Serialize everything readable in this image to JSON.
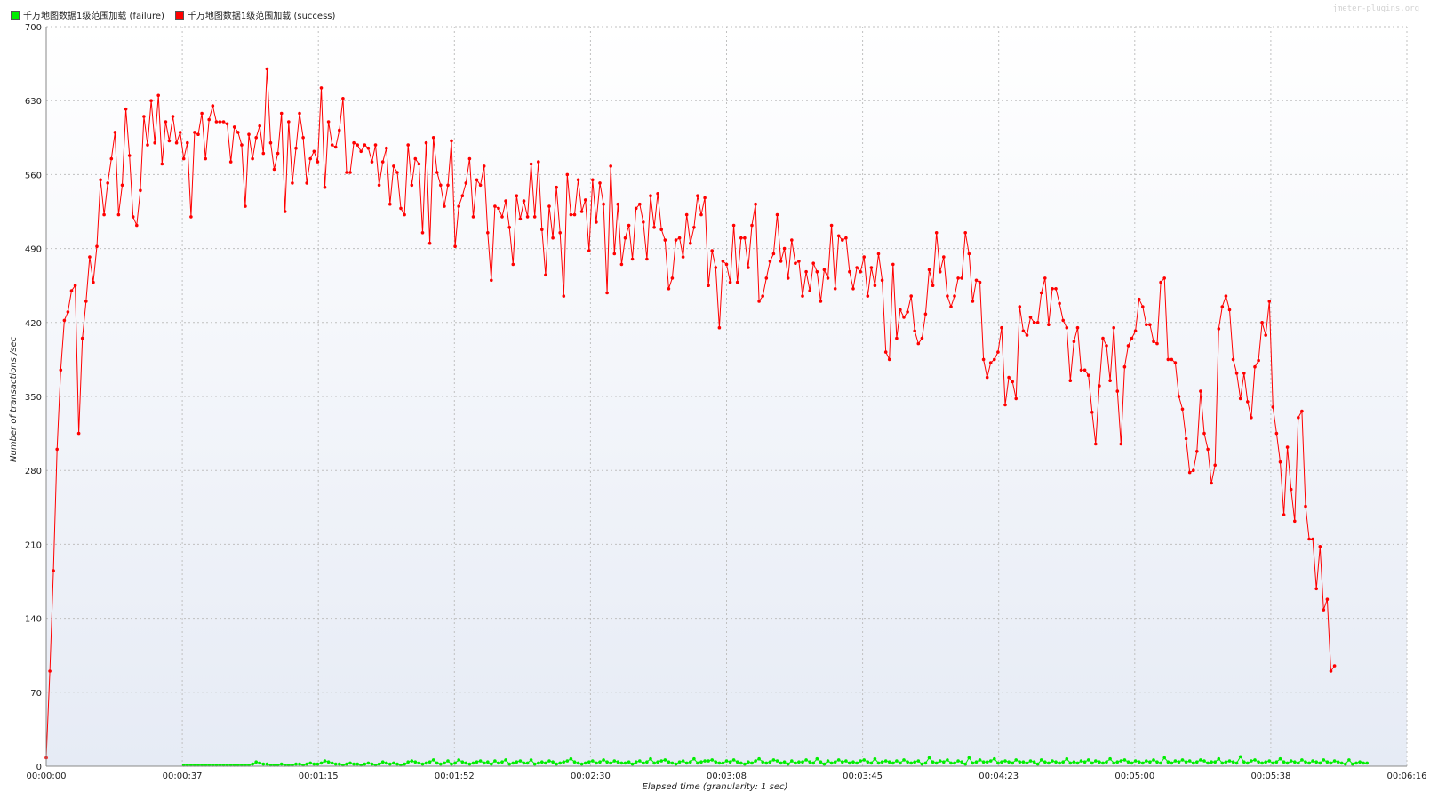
{
  "watermark": "jmeter-plugins.org",
  "colors": {
    "failure": "#00ee00",
    "success": "#ff0000",
    "grid": "#c0c0c0",
    "plot_bg_top": "#ffffff",
    "plot_bg_bottom": "#e6ebf5"
  },
  "legend": [
    {
      "label": "千万地图数据1级范围加载 (failure)",
      "color": "#00ee00"
    },
    {
      "label": "千万地图数据1级范围加载 (success)",
      "color": "#ff0000"
    }
  ],
  "chart_data": {
    "type": "line",
    "title": "",
    "xlabel": "Elapsed time (granularity: 1 sec)",
    "ylabel": "Number of transactions /sec",
    "xlim_seconds": [
      0,
      376
    ],
    "ylim": [
      0,
      700
    ],
    "y_ticks": [
      0,
      70,
      140,
      210,
      280,
      350,
      420,
      490,
      560,
      630,
      700
    ],
    "x_ticks": [
      "00:00:00",
      "00:00:37",
      "00:01:15",
      "00:01:52",
      "00:02:30",
      "00:03:08",
      "00:03:45",
      "00:04:23",
      "00:05:00",
      "00:05:38",
      "00:06:16"
    ],
    "grid": true,
    "legend_position": "top-left",
    "series": [
      {
        "name": "千万地图数据1级范围加载 (failure)",
        "color": "#00ee00",
        "x_start_seconds": 38,
        "x_step_seconds": 1,
        "values": [
          1,
          1,
          1,
          1,
          1,
          1,
          1,
          1,
          1,
          1,
          1,
          1,
          1,
          1,
          1,
          1,
          1,
          1,
          1,
          2,
          4,
          3,
          2,
          2,
          1,
          1,
          1,
          2,
          1,
          1,
          1,
          2,
          2,
          1,
          2,
          3,
          2,
          2,
          3,
          5,
          4,
          3,
          2,
          2,
          1,
          2,
          3,
          2,
          2,
          1,
          2,
          3,
          2,
          1,
          2,
          4,
          3,
          2,
          3,
          2,
          1,
          2,
          4,
          5,
          4,
          3,
          2,
          3,
          4,
          6,
          3,
          2,
          3,
          5,
          2,
          3,
          6,
          4,
          3,
          2,
          3,
          4,
          5,
          3,
          4,
          2,
          5,
          3,
          4,
          6,
          2,
          3,
          4,
          5,
          3,
          3,
          6,
          2,
          3,
          4,
          3,
          5,
          4,
          2,
          3,
          4,
          5,
          7,
          4,
          3,
          2,
          3,
          4,
          5,
          3,
          4,
          6,
          4,
          3,
          5,
          4,
          3,
          3,
          4,
          2,
          4,
          5,
          3,
          4,
          7,
          3,
          4,
          5,
          6,
          4,
          3,
          2,
          4,
          5,
          3,
          4,
          7,
          3,
          4,
          5,
          5,
          6,
          4,
          3,
          3,
          5,
          4,
          6,
          4,
          3,
          2,
          4,
          3,
          5,
          7,
          4,
          3,
          4,
          6,
          5,
          3,
          4,
          2,
          5,
          3,
          4,
          4,
          6,
          4,
          3,
          7,
          4,
          2,
          5,
          3,
          4,
          6,
          4,
          5,
          3,
          4,
          3,
          5,
          6,
          4,
          3,
          7,
          3,
          4,
          5,
          4,
          3,
          5,
          3,
          6,
          4,
          3,
          4,
          5,
          2,
          3,
          8,
          4,
          3,
          5,
          4,
          6,
          3,
          3,
          5,
          4,
          2,
          8,
          3,
          4,
          6,
          4,
          4,
          5,
          7,
          3,
          4,
          5,
          4,
          3,
          6,
          4,
          4,
          3,
          5,
          4,
          2,
          6,
          4,
          3,
          5,
          4,
          3,
          4,
          7,
          3,
          4,
          3,
          5,
          4,
          6,
          3,
          5,
          4,
          3,
          4,
          7,
          3,
          4,
          5,
          6,
          4,
          3,
          5,
          4,
          3,
          5,
          4,
          6,
          4,
          3,
          8,
          4,
          3,
          5,
          4,
          6,
          4,
          5,
          3,
          4,
          6,
          5,
          3,
          4,
          4,
          7,
          3,
          4,
          5,
          4,
          3,
          9,
          4,
          3,
          5,
          6,
          4,
          3,
          4,
          5,
          3,
          4,
          7,
          4,
          3,
          5,
          4,
          3,
          6,
          4,
          3,
          5,
          4,
          3,
          6,
          4,
          3,
          5,
          4,
          3,
          2,
          6,
          2,
          3,
          4,
          3,
          3
        ]
      },
      {
        "name": "千万地图数据1级范围加载 (success)",
        "color": "#ff0000",
        "x_start_seconds": 0,
        "x_step_seconds": 1,
        "values": [
          8,
          90,
          185,
          300,
          375,
          422,
          430,
          450,
          455,
          315,
          405,
          440,
          482,
          458,
          492,
          555,
          522,
          552,
          575,
          600,
          522,
          550,
          622,
          578,
          520,
          512,
          545,
          615,
          588,
          630,
          590,
          635,
          570,
          610,
          592,
          615,
          590,
          600,
          575,
          590,
          520,
          600,
          598,
          618,
          575,
          612,
          625,
          610,
          610,
          610,
          608,
          572,
          605,
          600,
          588,
          530,
          598,
          575,
          595,
          606,
          580,
          660,
          590,
          565,
          580,
          618,
          525,
          610,
          552,
          585,
          618,
          595,
          552,
          575,
          582,
          572,
          642,
          548,
          610,
          588,
          586,
          602,
          632,
          562,
          562,
          590,
          588,
          582,
          588,
          585,
          572,
          588,
          550,
          572,
          585,
          532,
          568,
          562,
          528,
          522,
          588,
          550,
          575,
          570,
          505,
          590,
          495,
          595,
          562,
          550,
          530,
          550,
          592,
          492,
          530,
          540,
          552,
          575,
          520,
          555,
          550,
          568,
          505,
          460,
          530,
          528,
          520,
          535,
          510,
          475,
          540,
          518,
          535,
          520,
          570,
          520,
          572,
          508,
          465,
          530,
          500,
          548,
          505,
          445,
          560,
          522,
          522,
          555,
          525,
          536,
          488,
          555,
          515,
          552,
          532,
          448,
          568,
          485,
          532,
          475,
          500,
          512,
          480,
          528,
          532,
          515,
          480,
          540,
          510,
          542,
          508,
          498,
          452,
          462,
          498,
          500,
          482,
          522,
          495,
          510,
          540,
          522,
          538,
          455,
          488,
          472,
          415,
          478,
          475,
          458,
          512,
          458,
          500,
          500,
          472,
          512,
          532,
          440,
          445,
          462,
          478,
          485,
          522,
          478,
          490,
          462,
          498,
          476,
          478,
          445,
          468,
          450,
          476,
          468,
          440,
          470,
          462,
          512,
          452,
          502,
          498,
          500,
          468,
          452,
          472,
          468,
          482,
          445,
          472,
          455,
          485,
          460,
          392,
          385,
          475,
          405,
          432,
          425,
          430,
          445,
          412,
          400,
          405,
          428,
          470,
          455,
          505,
          468,
          482,
          445,
          435,
          445,
          462,
          462,
          505,
          485,
          440,
          460,
          458,
          385,
          368,
          382,
          385,
          392,
          415,
          342,
          368,
          364,
          348,
          435,
          412,
          408,
          425,
          420,
          420,
          448,
          462,
          418,
          452,
          452,
          438,
          422,
          415,
          365,
          402,
          415,
          375,
          375,
          370,
          335,
          305,
          360,
          405,
          398,
          365,
          415,
          355,
          305,
          378,
          398,
          405,
          412,
          442,
          435,
          418,
          418,
          402,
          400,
          458,
          462,
          385,
          385,
          382,
          350,
          338,
          310,
          278,
          280,
          298,
          355,
          315,
          300,
          268,
          285,
          414,
          435,
          445,
          432,
          385,
          372,
          348,
          372,
          345,
          330,
          378,
          384,
          420,
          408,
          440,
          340,
          315,
          288,
          238,
          302,
          262,
          232,
          330,
          336,
          246,
          215,
          215,
          168,
          208,
          148,
          158,
          90,
          95
        ]
      }
    ]
  }
}
